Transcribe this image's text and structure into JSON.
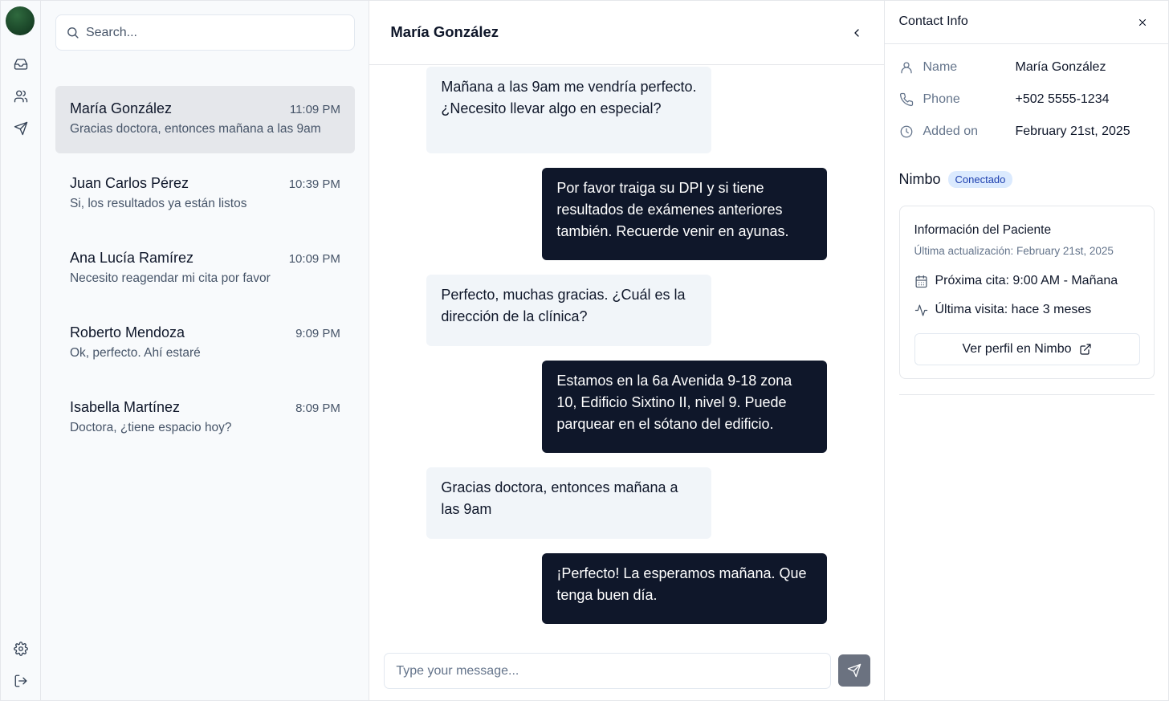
{
  "search": {
    "placeholder": "Search..."
  },
  "conversations": [
    {
      "name": "María González",
      "time": "11:09 PM",
      "preview": "Gracias doctora, entonces mañana a las 9am",
      "active": true
    },
    {
      "name": "Juan Carlos Pérez",
      "time": "10:39 PM",
      "preview": "Si, los resultados ya están listos"
    },
    {
      "name": "Ana Lucía Ramírez",
      "time": "10:09 PM",
      "preview": "Necesito reagendar mi cita por favor"
    },
    {
      "name": "Roberto Mendoza",
      "time": "9:09 PM",
      "preview": "Ok, perfecto. Ahí estaré"
    },
    {
      "name": "Isabella Martínez",
      "time": "8:09 PM",
      "preview": "Doctora, ¿tiene espacio hoy?"
    }
  ],
  "chat": {
    "title": "María González",
    "messages": [
      {
        "direction": "in",
        "text": "Mañana a las 9am me vendría perfecto. ¿Necesito llevar algo en especial?"
      },
      {
        "direction": "out",
        "text": "Por favor traiga su DPI y si tiene resultados de exámenes anteriores también. Recuerde venir en ayunas."
      },
      {
        "direction": "in",
        "text": "Perfecto, muchas gracias. ¿Cuál es la dirección de la clínica?"
      },
      {
        "direction": "out",
        "text": "Estamos en la 6a Avenida 9-18 zona 10, Edificio Sixtino II, nivel 9. Puede parquear en el sótano del edificio."
      },
      {
        "direction": "in",
        "text": "Gracias doctora, entonces mañana a las 9am"
      },
      {
        "direction": "out",
        "text": "¡Perfecto! La esperamos mañana. Que tenga buen día."
      }
    ],
    "composer_placeholder": "Type your message..."
  },
  "contact": {
    "title": "Contact Info",
    "fields": [
      {
        "icon": "user-icon",
        "label": "Name",
        "value": "María González"
      },
      {
        "icon": "phone-icon",
        "label": "Phone",
        "value": "+502 5555-1234"
      },
      {
        "icon": "clock-icon",
        "label": "Added on",
        "value": "February 21st, 2025"
      }
    ],
    "nimbo": {
      "title": "Nimbo",
      "status": "Conectado",
      "card_title": "Información del Paciente",
      "last_update": "Última actualización: February 21st, 2025",
      "next_appointment": "Próxima cita: 9:00 AM - Mañana",
      "last_visit": "Última visita: hace 3 meses",
      "profile_button": "Ver perfil en Nimbo"
    }
  },
  "colors": {
    "outgoing_bubble": "#0f172a",
    "incoming_bubble": "#f1f5f9",
    "active_conversation": "#e5e7eb",
    "badge_bg": "#dbeafe",
    "badge_text": "#1e40af",
    "send_button": "#6b7280"
  }
}
